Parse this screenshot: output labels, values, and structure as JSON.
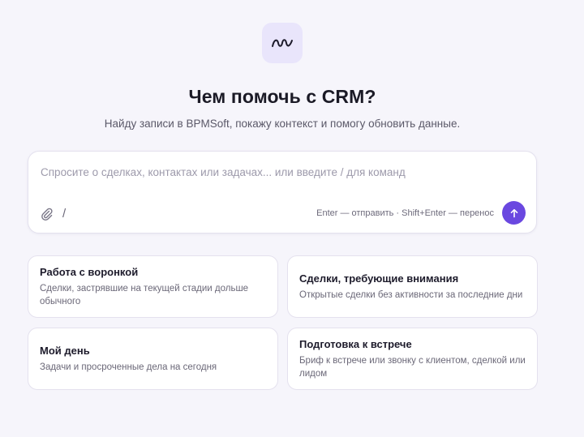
{
  "header": {
    "logo_icon": "wave-logo-icon",
    "title": "Чем помочь с CRM?",
    "subtitle": "Найду записи в BPMSoft, покажу контекст и помогу обновить данные."
  },
  "composer": {
    "placeholder": "Спросите о сделках, контактах или задачах... или введите / для команд",
    "value": "",
    "attach_icon": "paperclip-icon",
    "slash_label": "/",
    "hint": "Enter — отправить · Shift+Enter — перенос",
    "send_icon": "arrow-up-icon"
  },
  "suggestions": [
    {
      "title": "Работа с воронкой",
      "description": "Сделки, застрявшие на текущей стадии дольше обычного"
    },
    {
      "title": "Сделки, требующие внимания",
      "description": "Открытые сделки без активности за последние дни"
    },
    {
      "title": "Мой день",
      "description": "Задачи и просроченные дела на сегодня"
    },
    {
      "title": "Подготовка к встрече",
      "description": "Бриф к встрече или звонку с клиентом, сделкой или лидом"
    }
  ],
  "colors": {
    "accent": "#6a48e0",
    "background": "#f6f5fb",
    "logo_tile": "#e9e5fb"
  }
}
